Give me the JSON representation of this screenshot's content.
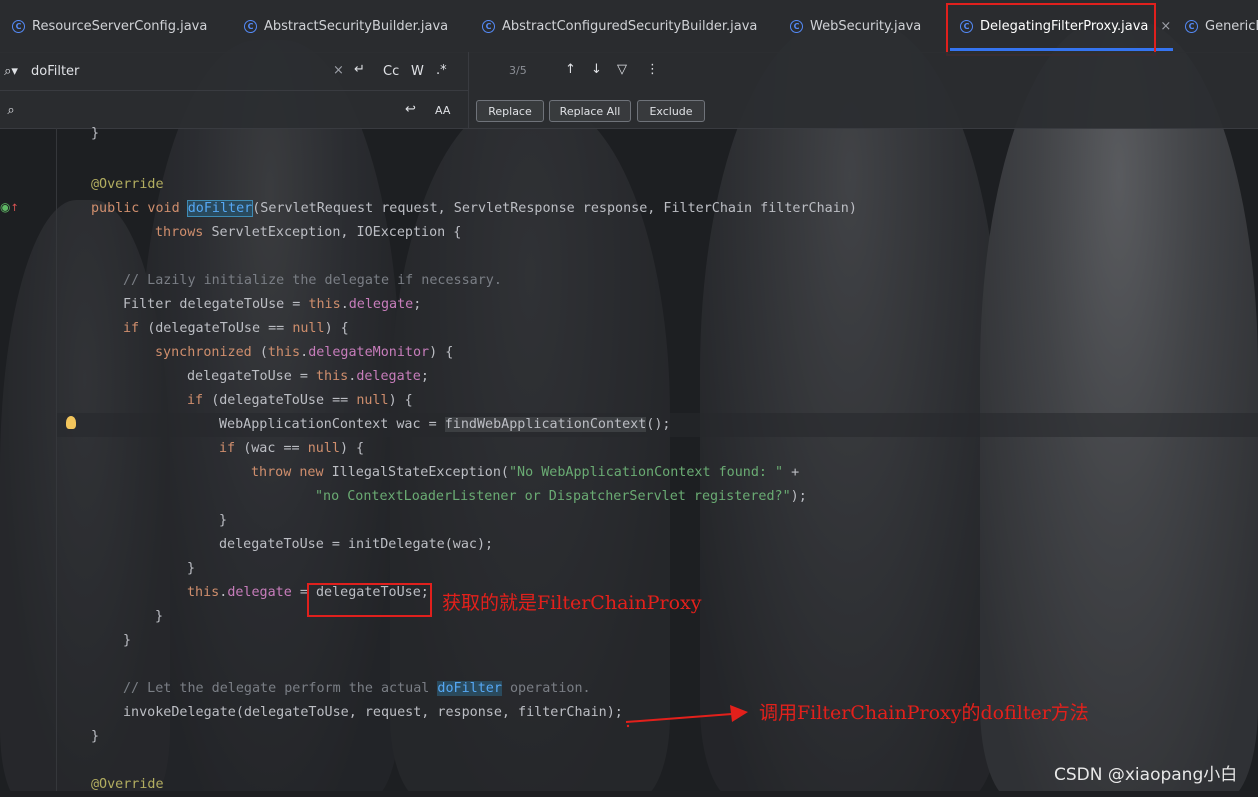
{
  "tabs": [
    {
      "label": "ResourceServerConfig.java",
      "icon": "class-icon"
    },
    {
      "label": "AbstractSecurityBuilder.java",
      "icon": "class-icon"
    },
    {
      "label": "AbstractConfiguredSecurityBuilder.java",
      "icon": "class-icon"
    },
    {
      "label": "WebSecurity.java",
      "icon": "class-icon"
    },
    {
      "label": "DelegatingFilterProxy.java",
      "icon": "class-icon",
      "active": true
    },
    {
      "label": "GenericF",
      "icon": "class-icon"
    }
  ],
  "find": {
    "search_value": "doFilter",
    "match_case": "Cc",
    "words": "W",
    "regex": ".*",
    "match_count": "3/5"
  },
  "replace": {
    "value": "",
    "replace_label": "Replace",
    "replace_all_label": "Replace All",
    "exclude_label": "Exclude"
  },
  "annotations": {
    "note1": "获取的就是FilterChainProxy",
    "note2": "调用FilterChainProxy的dofilter方法"
  },
  "watermark": "CSDN @xiaopang小白",
  "colors": {
    "accent": "#3574f0",
    "annotation_red": "#e0201d",
    "background": "#1e1f22"
  }
}
